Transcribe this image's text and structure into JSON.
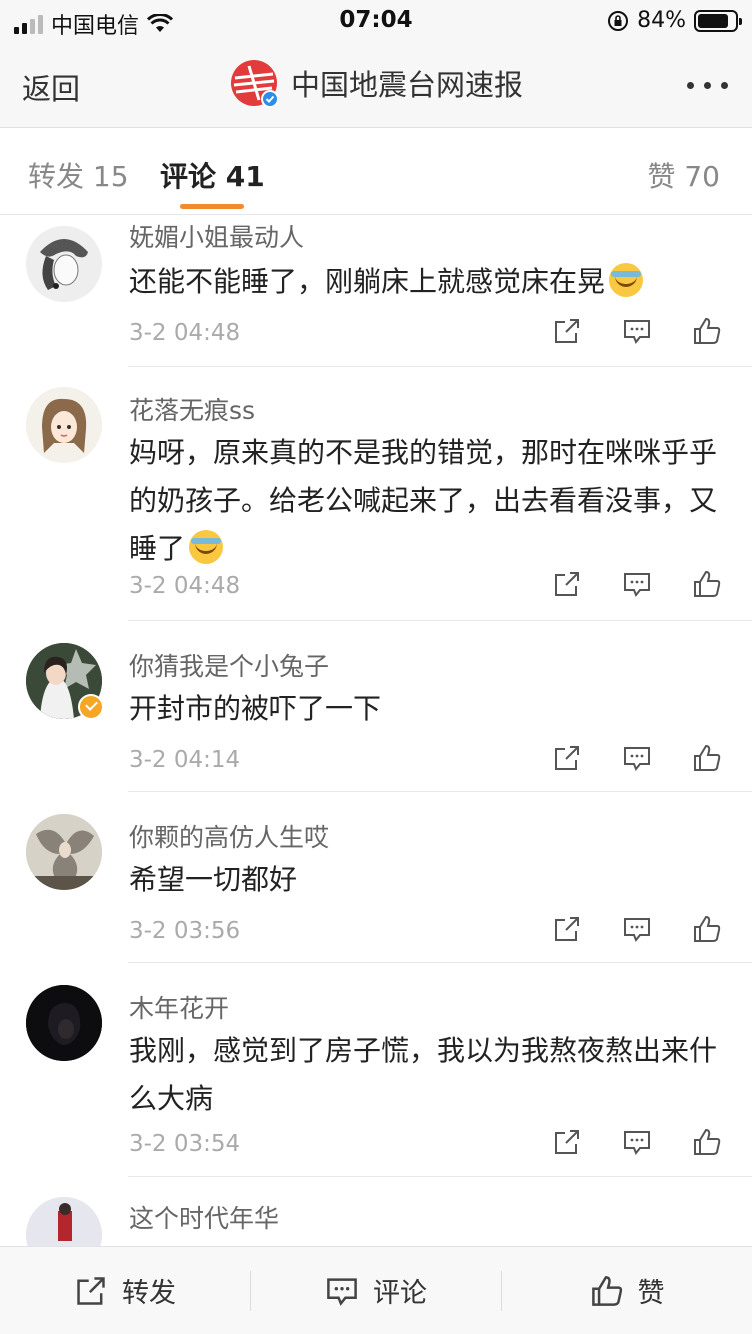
{
  "status_bar": {
    "carrier": "中国电信",
    "time": "07:04",
    "battery_percent": "84%",
    "battery_level": 0.84
  },
  "nav": {
    "back_label": "返回",
    "title": "中国地震台网速报"
  },
  "tabs": {
    "repost": {
      "label": "转发",
      "count": "15"
    },
    "comment": {
      "label": "评论",
      "count": "41"
    },
    "like": {
      "label": "赞",
      "count": "70"
    }
  },
  "comments": [
    {
      "user": "妩媚小姐最动人",
      "text": "还能不能睡了，刚躺床上就感觉床在晃",
      "emoji": true,
      "time": "3-2 04:48"
    },
    {
      "user": "花落无痕ss",
      "text": "妈呀，原来真的不是我的错觉，那时在咪咪乎乎的奶孩子。给老公喊起来了，出去看看没事，又睡了",
      "emoji": true,
      "time": "3-2 04:48"
    },
    {
      "user": "你猜我是个小兔子",
      "text": "开封市的被吓了一下",
      "emoji": false,
      "time": "3-2 04:14"
    },
    {
      "user": "你颗的高仿人生哎",
      "text": "希望一切都好",
      "emoji": false,
      "time": "3-2 03:56"
    },
    {
      "user": "木年花开",
      "text": "我刚，感觉到了房子慌，我以为我熬夜熬出来什么大病",
      "emoji": false,
      "time": "3-2 03:54"
    },
    {
      "user": "这个时代年华"
    }
  ],
  "bottom_bar": {
    "repost": "转发",
    "comment": "评论",
    "like": "赞"
  },
  "colors": {
    "tab_indicator": "#f28b30",
    "verified_badge": "#f5a623",
    "logo_red": "#e23b3b"
  }
}
